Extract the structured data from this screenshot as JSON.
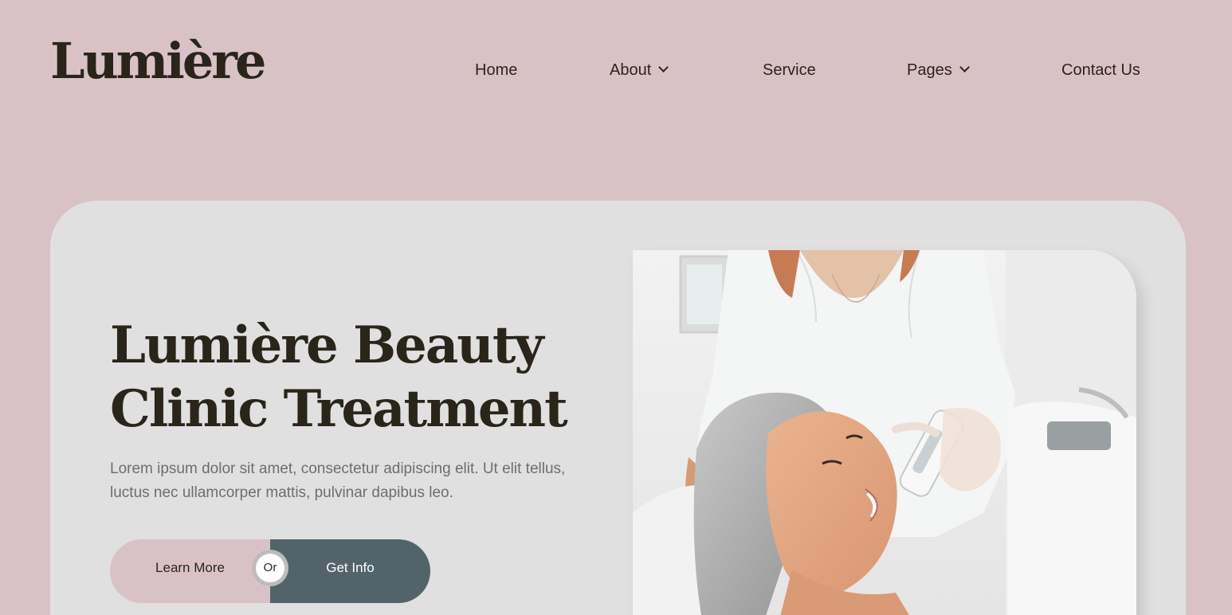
{
  "brand": {
    "logo_text": "Lumière"
  },
  "nav": {
    "items": [
      {
        "label": "Home",
        "dropdown": false
      },
      {
        "label": "About",
        "dropdown": true
      },
      {
        "label": "Service",
        "dropdown": false
      },
      {
        "label": "Pages",
        "dropdown": true
      },
      {
        "label": "Contact Us",
        "dropdown": false
      }
    ]
  },
  "hero": {
    "title_line1": "Lumière Beauty",
    "title_line2": "Clinic Treatment",
    "description_line1": "Lorem ipsum dolor sit amet, consectetur adipiscing elit. Ut elit tellus,",
    "description_line2": "luctus nec ullamcorper mattis, pulvinar dapibus leo.",
    "learn_more_label": "Learn More",
    "or_label": "Or",
    "get_info_label": "Get Info",
    "image_alt": "Beautician performing facial treatment on smiling gray-haired woman"
  },
  "colors": {
    "page_background": "#d9c2c6",
    "hero_background": "#e0e0e0",
    "text_dark": "#2a251b",
    "text_muted": "#6e6e6e",
    "button_secondary": "#52646a"
  }
}
